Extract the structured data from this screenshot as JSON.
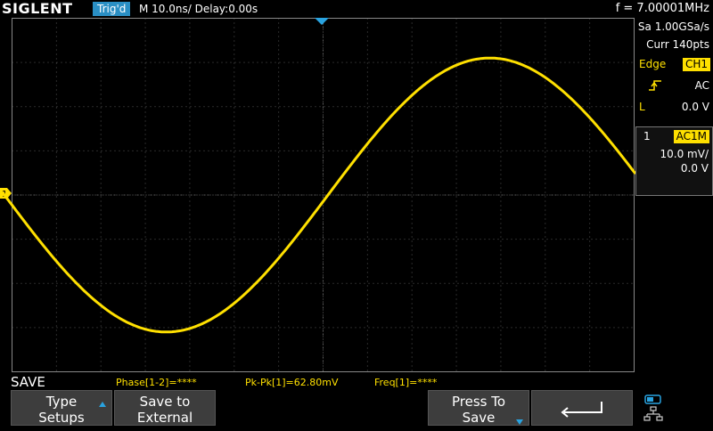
{
  "brand": "SIGLENT",
  "trigger_status": "Trig'd",
  "timebase": "M 10.0ns/",
  "delay": "Delay:0.00s",
  "frequency_readout": "f = 7.00001MHz",
  "right_panel": {
    "sample_rate": "Sa 1.00GSa/s",
    "memory_depth": "Curr 140pts",
    "trigger_type": "Edge",
    "trigger_source": "CH1",
    "trigger_coupling": "AC",
    "trigger_level_label": "L",
    "trigger_level": "0.0 V",
    "channel_number": "1",
    "channel_coupling": "AC1M",
    "channel_scale": "10.0 mV/",
    "channel_offset": "0.0 V"
  },
  "channel_marker": "1",
  "menu_title": "SAVE",
  "measurements": {
    "phase": "Phase[1-2]=****",
    "pkpk": "Pk-Pk[1]=62.80mV",
    "freq": "Freq[1]=****"
  },
  "softkeys": {
    "type_line1": "Type",
    "type_line2": "Setups",
    "save_external_line1": "Save to",
    "save_external_line2": "External",
    "press_line1": "Press To",
    "press_line2": "Save"
  },
  "waveform": {
    "amplitude_div": 3.1,
    "phase": "inverted",
    "color": "#ffe000"
  },
  "colors": {
    "trace": "#ffe000",
    "accent": "#29a3e0",
    "softkey_bg": "#3d3d3d"
  }
}
